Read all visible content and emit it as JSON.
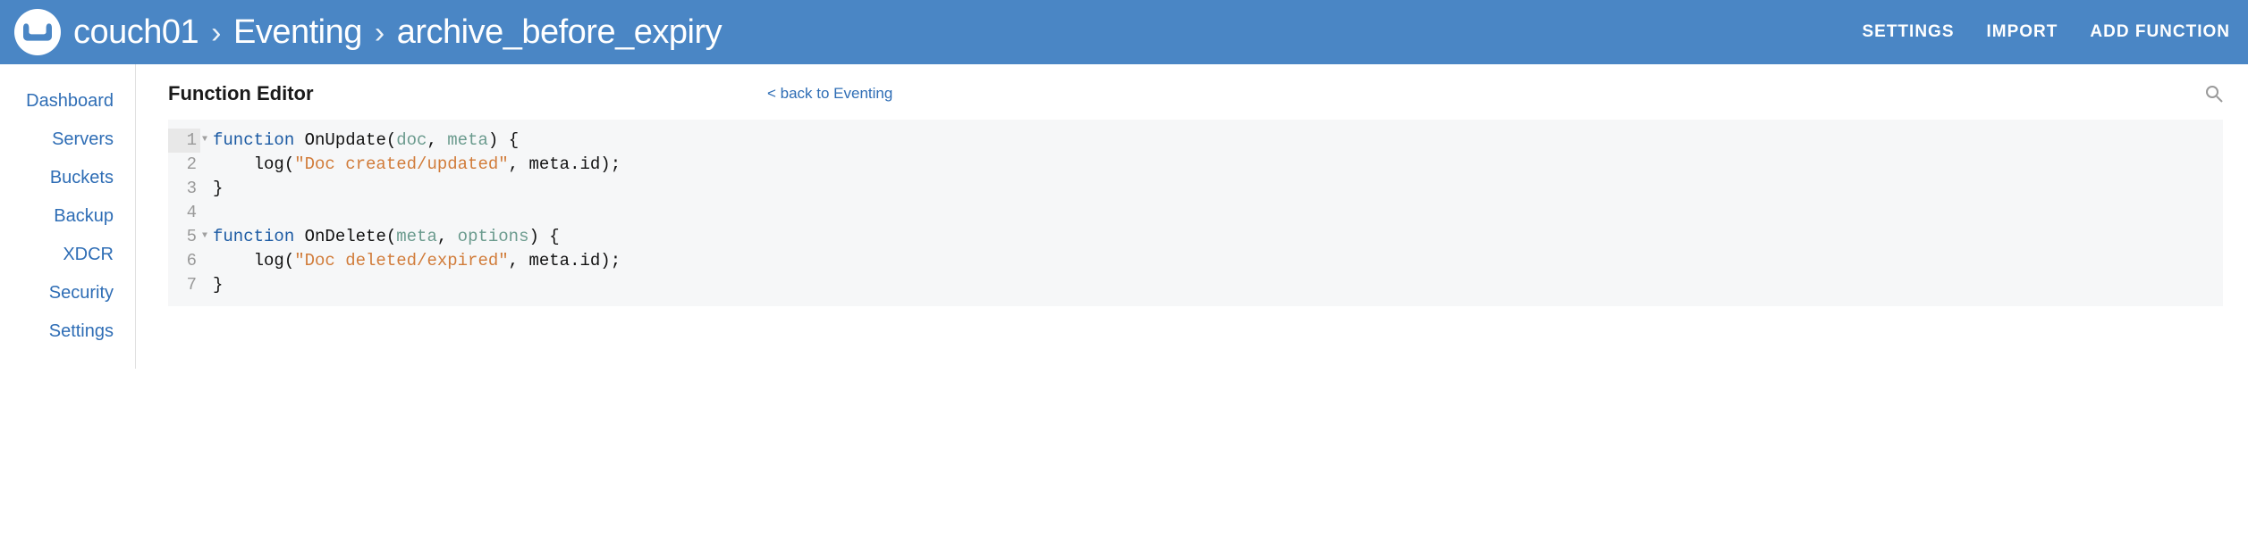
{
  "header": {
    "breadcrumb": [
      "couch01",
      "Eventing",
      "archive_before_expiry"
    ],
    "actions": {
      "settings": "SETTINGS",
      "import": "IMPORT",
      "add_function": "ADD FUNCTION"
    }
  },
  "sidebar": {
    "items": [
      {
        "label": "Dashboard"
      },
      {
        "label": "Servers"
      },
      {
        "label": "Buckets"
      },
      {
        "label": "Backup"
      },
      {
        "label": "XDCR"
      },
      {
        "label": "Security"
      },
      {
        "label": "Settings"
      }
    ]
  },
  "main": {
    "title": "Function Editor",
    "back_link": "< back to Eventing"
  },
  "code": {
    "lines": [
      {
        "num": "1",
        "fold": true,
        "tokens": [
          {
            "t": "kw",
            "v": "function"
          },
          {
            "t": "p",
            "v": " "
          },
          {
            "t": "fn",
            "v": "OnUpdate"
          },
          {
            "t": "p",
            "v": "("
          },
          {
            "t": "param",
            "v": "doc"
          },
          {
            "t": "p",
            "v": ", "
          },
          {
            "t": "param",
            "v": "meta"
          },
          {
            "t": "p",
            "v": ") {"
          }
        ]
      },
      {
        "num": "2",
        "fold": false,
        "tokens": [
          {
            "t": "p",
            "v": "    log("
          },
          {
            "t": "str",
            "v": "\"Doc created/updated\""
          },
          {
            "t": "p",
            "v": ", meta.id);"
          }
        ]
      },
      {
        "num": "3",
        "fold": false,
        "tokens": [
          {
            "t": "p",
            "v": "}"
          }
        ]
      },
      {
        "num": "4",
        "fold": false,
        "tokens": []
      },
      {
        "num": "5",
        "fold": true,
        "tokens": [
          {
            "t": "kw",
            "v": "function"
          },
          {
            "t": "p",
            "v": " "
          },
          {
            "t": "fn",
            "v": "OnDelete"
          },
          {
            "t": "p",
            "v": "("
          },
          {
            "t": "param",
            "v": "meta"
          },
          {
            "t": "p",
            "v": ", "
          },
          {
            "t": "param",
            "v": "options"
          },
          {
            "t": "p",
            "v": ") {"
          }
        ]
      },
      {
        "num": "6",
        "fold": false,
        "tokens": [
          {
            "t": "p",
            "v": "    log("
          },
          {
            "t": "str",
            "v": "\"Doc deleted/expired\""
          },
          {
            "t": "p",
            "v": ", meta.id);"
          }
        ]
      },
      {
        "num": "7",
        "fold": false,
        "tokens": [
          {
            "t": "p",
            "v": "}"
          }
        ]
      }
    ]
  }
}
